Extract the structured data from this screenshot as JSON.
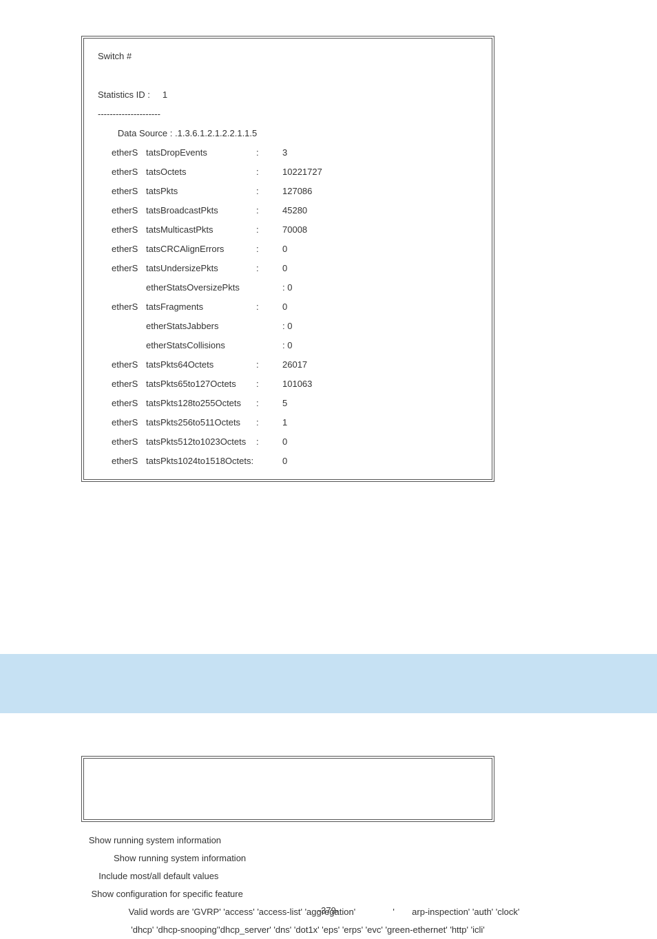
{
  "page_number": "-379-",
  "terminal": {
    "prompt": "Switch #",
    "stats_label": "Statistics ID :     1",
    "separator": "---------------------",
    "data_source": "        Data Source : .1.3.6.1.2.1.2.2.1.1.5",
    "rows": [
      {
        "p1": "etherS",
        "p2": "tatsDropEvents",
        "colon": ":",
        "val": "    3"
      },
      {
        "p1": "etherS",
        "p2": "tatsOctets",
        "colon": ":",
        "val": "     10221727"
      },
      {
        "p1": "etherS",
        "p2": "tatsPkts",
        "colon": ":",
        "val": "         127086"
      },
      {
        "p1": "etherS",
        "p2": "tatsBroadcastPkts",
        "colon": ":",
        "val": "    45280"
      },
      {
        "p1": "etherS",
        "p2": "tatsMulticastPkts",
        "colon": ":",
        "val": "    70008"
      },
      {
        "p1": "etherS",
        "p2": "tatsCRCAlignErrors",
        "colon": ":",
        "val": "   0"
      },
      {
        "p1": "etherS",
        "p2": "tatsUndersizePkts",
        "colon": ":",
        "val": "    0"
      },
      {
        "p1": "",
        "p2": "   etherStatsOversizePkts",
        "colon": "",
        "val": "  : 0"
      },
      {
        "p1": "etherS",
        "p2": "tatsFragments",
        "colon": ":",
        "val": "    0"
      },
      {
        "p1": "",
        "p2": "   etherStatsJabbers",
        "colon": "",
        "val": "       : 0"
      },
      {
        "p1": "",
        "p2": "   etherStatsCollisions",
        "colon": "",
        "val": " : 0"
      },
      {
        "p1": "etherS",
        "p2": "tatsPkts64Octets",
        "colon": ":",
        "val": "     26017"
      },
      {
        "p1": "etherS",
        "p2": "tatsPkts65to127Octets",
        "colon": ":",
        "val": "  101063"
      },
      {
        "p1": "etherS",
        "p2": "tatsPkts128to255Octets",
        "colon": ":",
        "val": " 5"
      },
      {
        "p1": "etherS",
        "p2": "tatsPkts256to511Octets",
        "colon": ":",
        "val": " 1"
      },
      {
        "p1": "etherS",
        "p2": "tatsPkts512to1023Octets",
        "colon": ":",
        "val": "0"
      },
      {
        "p1": "etherS",
        "p2": "tatsPkts1024to1518Octets:",
        "colon": "",
        "val": "0"
      }
    ]
  },
  "definitions": {
    "l1": "   Show running system information",
    "l2": "             Show running system information",
    "l3": "       Include most/all default values",
    "l4": "    Show configuration for specific feature",
    "l5": "                   Valid words are 'GVRP' 'access' 'access-list' 'aggregation'               '       arp-inspection' 'auth' 'clock'",
    "l6": "                    'dhcp' 'dhcp-snooping''dhcp_server' 'dns' 'dot1x' 'eps' 'erps' 'evc' 'green-ethernet' 'http' 'icli'"
  }
}
